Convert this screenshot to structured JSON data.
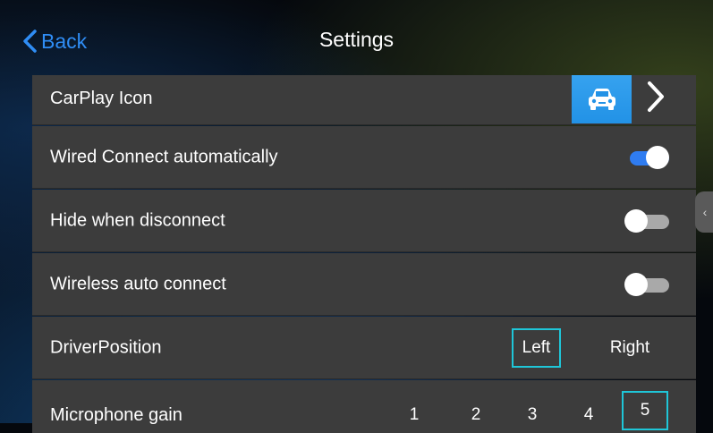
{
  "header": {
    "back_label": "Back",
    "title": "Settings"
  },
  "rows": {
    "carplay_icon": {
      "label": "CarPlay Icon"
    },
    "wired": {
      "label": "Wired Connect automatically",
      "enabled": true
    },
    "hide": {
      "label": "Hide when disconnect",
      "enabled": false
    },
    "wireless": {
      "label": "Wireless auto connect",
      "enabled": false
    },
    "driver": {
      "label": "DriverPosition",
      "options": [
        "Left",
        "Right"
      ],
      "selected": "Left"
    },
    "mic": {
      "label": "Microphone gain",
      "options": [
        "1",
        "2",
        "3",
        "4",
        "5"
      ],
      "selected": "5"
    }
  },
  "colors": {
    "accent_blue": "#2f7cf0",
    "select_outline": "#1fc6d8",
    "row_bg": "#3c3c3c"
  },
  "icons": {
    "back": "chevron-left-icon",
    "carplay": "car-icon",
    "more": "chevron-right-icon",
    "handle": "chevron-left-icon"
  }
}
